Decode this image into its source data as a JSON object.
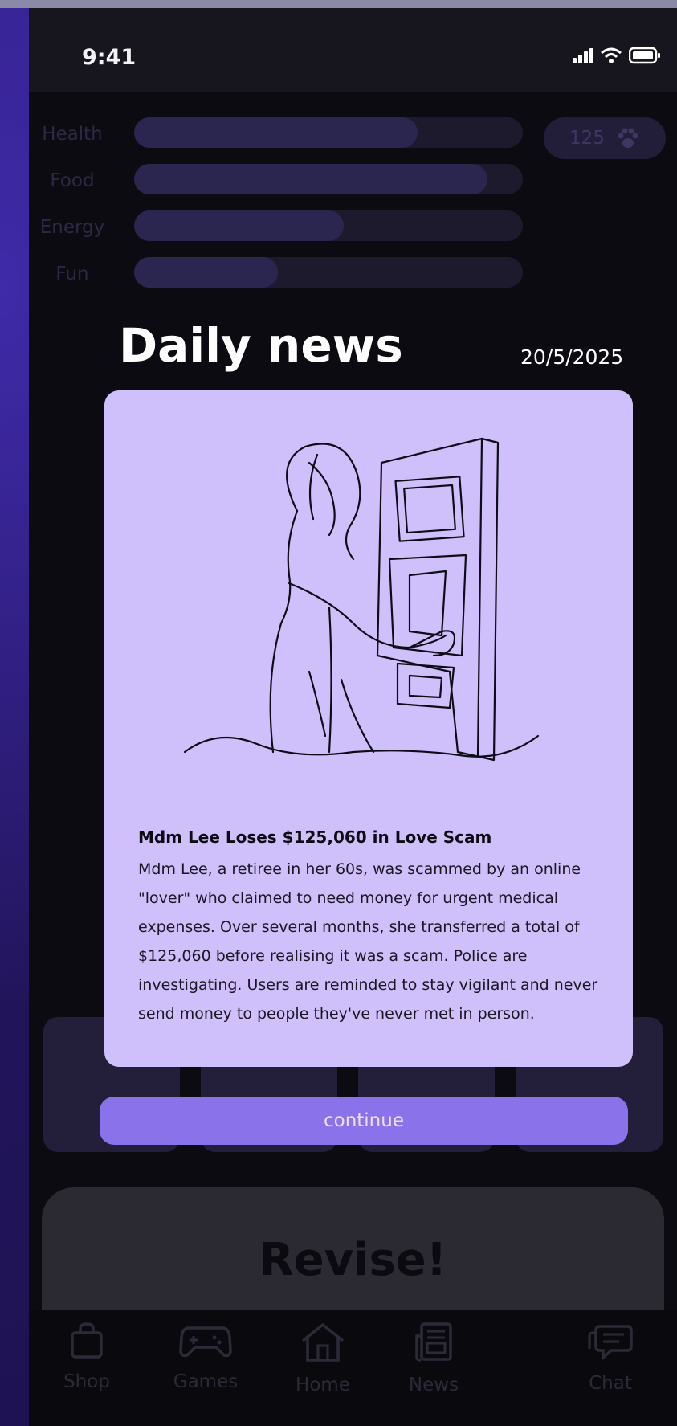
{
  "status_bar": {
    "time": "9:41"
  },
  "stats": [
    {
      "label": "Health",
      "fill": 0.73
    },
    {
      "label": "Food",
      "fill": 0.91
    },
    {
      "label": "Energy",
      "fill": 0.54
    },
    {
      "label": "Fun",
      "fill": 0.37
    }
  ],
  "coins": {
    "value": "125",
    "icon": "paw-icon"
  },
  "news": {
    "title": "Daily news",
    "date": "20/5/2025",
    "headline": "Mdm Lee Loses $125,060 in Love Scam",
    "body": "Mdm Lee, a retiree in her 60s, was scammed by an online \"lover\" who claimed to need money for urgent medical expenses. Over several months, she transferred a total of $125,060 before realising it was a scam. Police are investigating. Users are reminded to stay vigilant and never send money to people they've never met in person.",
    "continue_label": "continue"
  },
  "revise": {
    "label": "Revise!"
  },
  "nav": {
    "items": [
      {
        "label": "Shop",
        "icon": "shopping-bag-icon"
      },
      {
        "label": "Games",
        "icon": "gamepad-icon"
      },
      {
        "label": "Home",
        "icon": "home-icon"
      },
      {
        "label": "News",
        "icon": "newspaper-icon"
      },
      {
        "label": "Chat",
        "icon": "chat-icon"
      }
    ]
  },
  "colors": {
    "card": "#cfc0fb",
    "button": "#8a72ea",
    "bar_fill": "#2b2650",
    "background": "#0d0b12"
  }
}
